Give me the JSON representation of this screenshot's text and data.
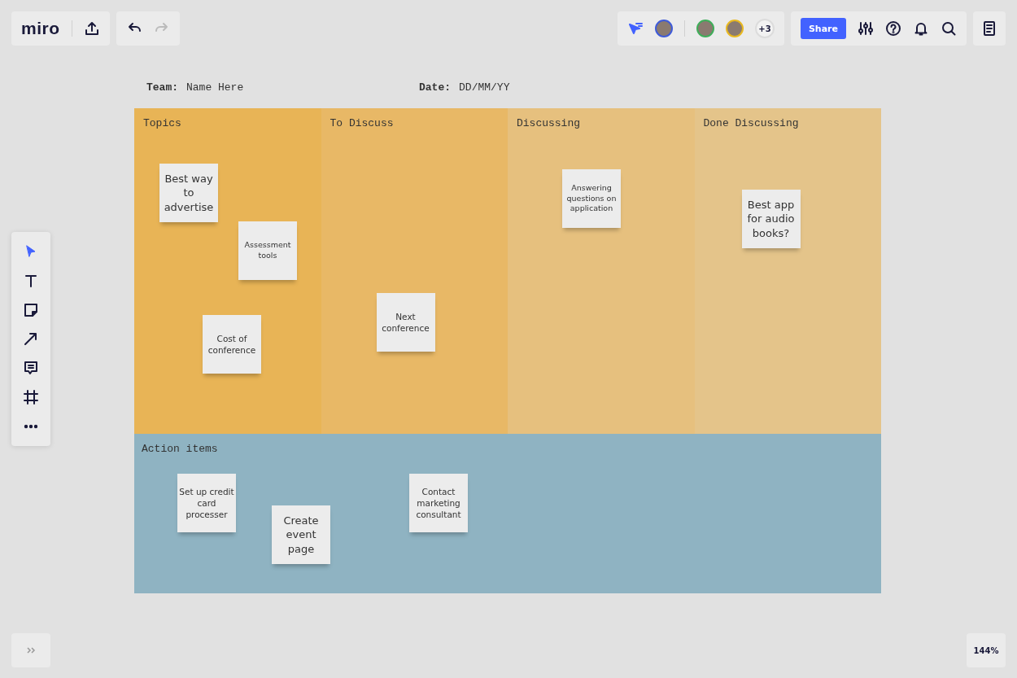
{
  "topbar": {
    "logo": "miro",
    "collaborators": [
      {
        "color": "#3f5bd8"
      },
      {
        "color": "#3fae5a"
      },
      {
        "color": "#e8b820"
      }
    ],
    "more_count": "+3",
    "share": "Share"
  },
  "zoom": "144%",
  "header": {
    "team_label": "Team:",
    "team_value": "Name Here",
    "date_label": "Date:",
    "date_value": "DD/MM/YY"
  },
  "columns": [
    {
      "title": "Topics",
      "color": "#e8b456",
      "notes": [
        {
          "text": "Best way to advertise",
          "kind": "large"
        },
        {
          "text": "Assessment tools",
          "kind": "small"
        },
        {
          "text": "Cost of conference",
          "kind": "medium"
        }
      ]
    },
    {
      "title": "To Discuss",
      "color": "#e8b866",
      "notes": [
        {
          "text": "Next conference",
          "kind": "medium"
        }
      ]
    },
    {
      "title": "Discussing",
      "color": "#e6c07e",
      "notes": [
        {
          "text": "Answering questions on application",
          "kind": "small"
        }
      ]
    },
    {
      "title": "Done Discussing",
      "color": "#e4c48a",
      "notes": [
        {
          "text": "Best app for audio books?",
          "kind": "large"
        }
      ]
    }
  ],
  "action": {
    "title": "Action items",
    "color": "#8fb3c2",
    "notes": [
      {
        "text": "Set up credit card processer",
        "kind": "medium"
      },
      {
        "text": "Create event page",
        "kind": "large"
      },
      {
        "text": "Contact marketing consultant",
        "kind": "medium"
      }
    ]
  }
}
